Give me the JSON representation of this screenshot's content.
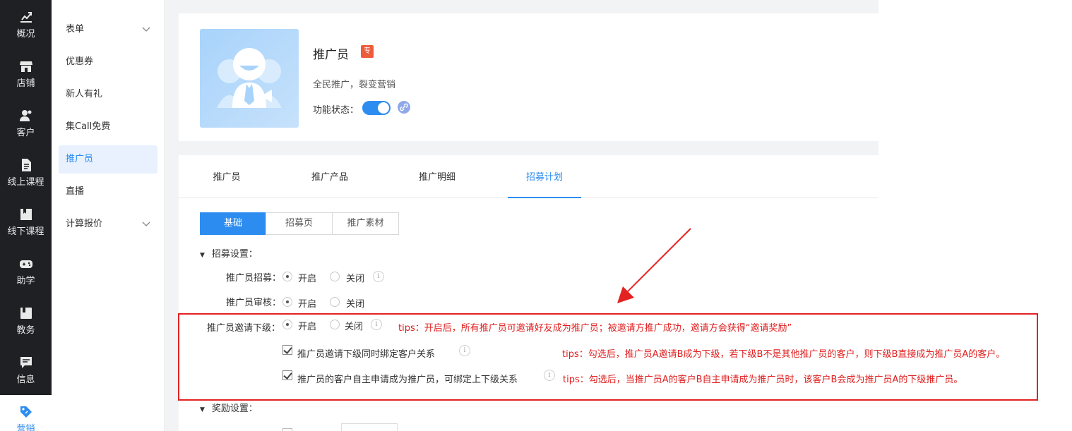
{
  "rail": {
    "items": [
      {
        "label": "概况",
        "icon": "chart-trend-icon"
      },
      {
        "label": "店铺",
        "icon": "store-icon"
      },
      {
        "label": "客户",
        "icon": "customers-icon"
      },
      {
        "label": "线上课程",
        "icon": "document-icon"
      },
      {
        "label": "线下课程",
        "icon": "classroom-icon"
      },
      {
        "label": "助学",
        "icon": "gamepad-icon"
      },
      {
        "label": "教务",
        "icon": "book-icon"
      },
      {
        "label": "信息",
        "icon": "message-icon"
      },
      {
        "label": "营销",
        "icon": "tag-icon"
      }
    ]
  },
  "submenu": {
    "items": [
      {
        "label": "表单",
        "chevron": "⌄"
      },
      {
        "label": "优惠券"
      },
      {
        "label": "新人有礼"
      },
      {
        "label": "集Call免费"
      },
      {
        "label": "推广员"
      },
      {
        "label": "直播"
      },
      {
        "label": "计算报价",
        "chevron": "⌄"
      }
    ]
  },
  "app": {
    "title": "推广员",
    "badge": "专",
    "description": "全民推广，裂变营销",
    "status_label": "功能状态：",
    "status_on": true
  },
  "tabs": [
    "推广员",
    "推广产品",
    "推广明细",
    "招募计划"
  ],
  "segments": [
    "基础",
    "招募页",
    "推广素材"
  ],
  "recruit": {
    "section_title": "招募设置：",
    "rows": [
      {
        "label": "推广员招募：",
        "on": "开启",
        "off": "关闭"
      },
      {
        "label": "推广员审核：",
        "on": "开启",
        "off": "关闭"
      },
      {
        "label": "推广员邀请下级：",
        "on": "开启",
        "off": "关闭"
      }
    ],
    "tip_invite": "tips：开启后，所有推广员可邀请好友成为推广员；被邀请方推广成功，邀请方会获得“邀请奖励”",
    "check1": "推广员邀请下级同时绑定客户关系",
    "tip1": "tips：勾选后，推广员A邀请B成为下级，若下级B不是其他推广员的客户，则下级B直接成为推广员A的客户。",
    "check2": "推广员的客户自主申请成为推广员，可绑定上下级关系",
    "tip2": "tips：勾选后，当推广员A的客户B自主申请成为推广员时，该客户B会成为推广员A的下级推广员。"
  },
  "reward": {
    "section_title": "奖励设置："
  },
  "colors": {
    "accent": "#2d8cf0",
    "rail_bg": "#1f2024",
    "annotation_red": "#e32222"
  }
}
